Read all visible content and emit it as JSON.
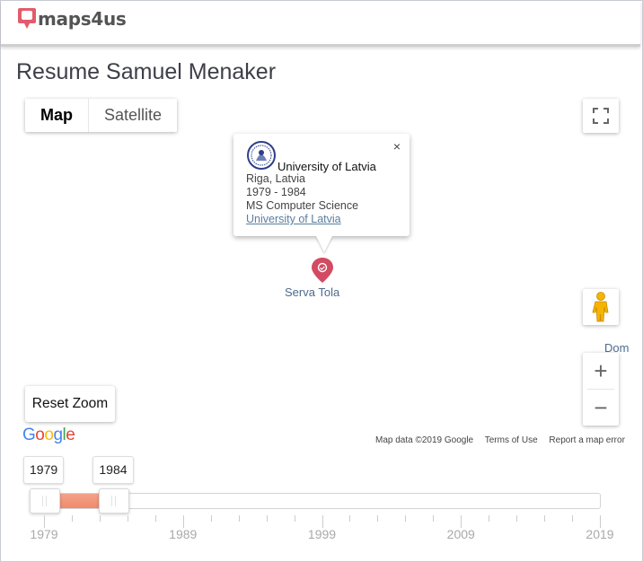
{
  "header": {
    "logo_text": "maps4us"
  },
  "page": {
    "title": "Resume Samuel Menaker"
  },
  "map": {
    "type_buttons": {
      "map": "Map",
      "satellite": "Satellite"
    },
    "infowindow": {
      "close": "×",
      "name": "University of Latvia",
      "location": "Riga, Latvia",
      "years": "1979 - 1984",
      "degree": "MS Computer Science",
      "link": "University of Latvia"
    },
    "pin_label": "Serva Tola",
    "edge_label": "Dom",
    "zoom_in": "+",
    "zoom_out": "−",
    "reset_zoom": "Reset Zoom",
    "attribution": {
      "data": "Map data ©2019 Google",
      "terms": "Terms of Use",
      "report": "Report a map error"
    },
    "google_logo": [
      "G",
      "o",
      "o",
      "g",
      "l",
      "e"
    ],
    "google_colors": [
      "#4285F4",
      "#EA4335",
      "#FBBC05",
      "#4285F4",
      "#34A853",
      "#EA4335"
    ],
    "pin_color": "#d24b62"
  },
  "timeline": {
    "min": 1979,
    "max": 2019,
    "range_start_label": "1979",
    "range_end_label": "1984",
    "range_start": 1979,
    "range_end": 1984,
    "tick_labels": [
      "1979",
      "1989",
      "1999",
      "2009",
      "2019"
    ],
    "fill_color": "#ef8a6b"
  }
}
